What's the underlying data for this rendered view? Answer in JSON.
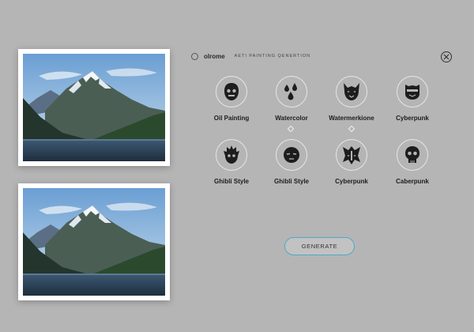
{
  "header": {
    "brand": "olrome",
    "tagline": "AETI PAINTING QENERTION"
  },
  "styles": [
    {
      "label": "Oil Painting",
      "icon": "face-mask-icon"
    },
    {
      "label": "Watercolor",
      "icon": "water-drops-icon"
    },
    {
      "label": "Watermerkione",
      "icon": "horned-mask-icon"
    },
    {
      "label": "Cyberpunk",
      "icon": "cyber-helmet-icon"
    },
    {
      "label": "Ghibli Style",
      "icon": "flame-creature-icon"
    },
    {
      "label": "Ghibli Style",
      "icon": "round-face-icon"
    },
    {
      "label": "Cyberpunk",
      "icon": "armored-warrior-icon"
    },
    {
      "label": "Caberpunk",
      "icon": "skull-icon"
    }
  ],
  "generate_label": "GENERATE",
  "colors": {
    "background": "#b5b5b5",
    "button_border": "#4fa8c9",
    "icon_ring": "#e6e6e6"
  }
}
